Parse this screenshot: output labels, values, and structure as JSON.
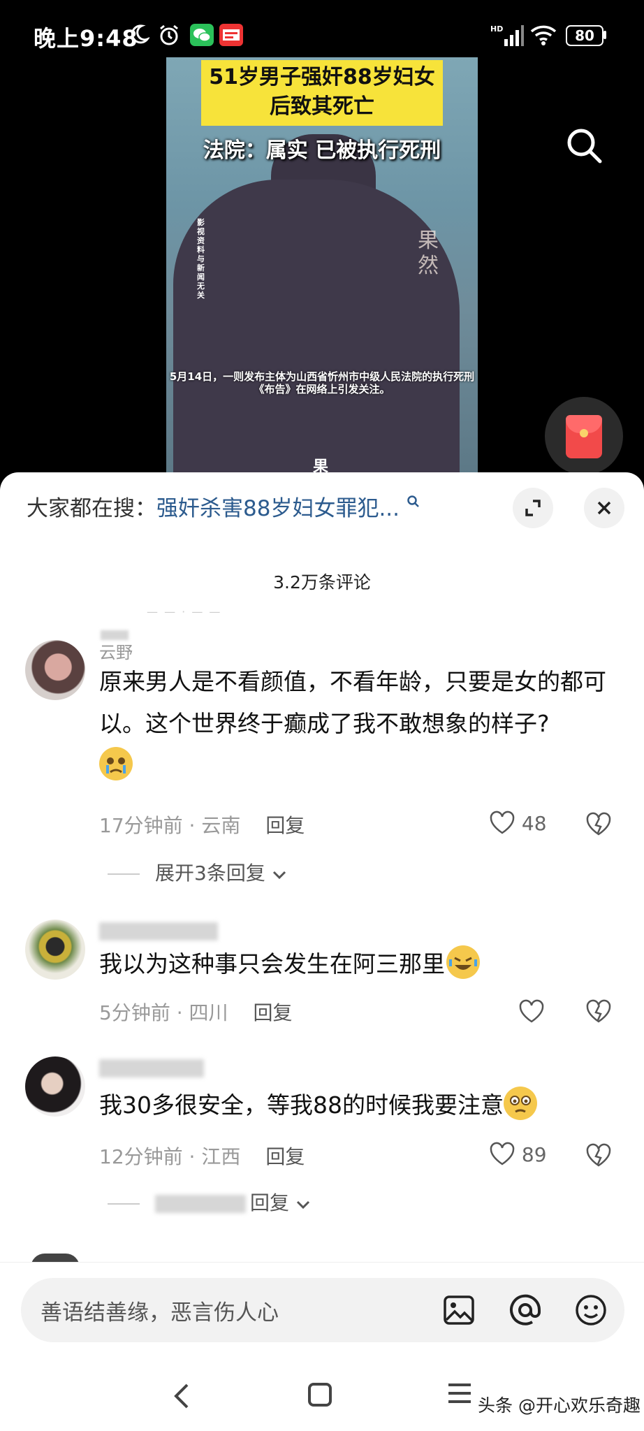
{
  "status_bar": {
    "time": "晚上9:48",
    "network": "HD",
    "battery": "80"
  },
  "video": {
    "headline": "51岁男子强奸88岁妇女后致其死亡",
    "court_line": "法院：属实 已被执行死刑",
    "side_note": "影视资料与新闻无关",
    "watermark": "果然",
    "caption": "5月14日，一则发布主体为山西省忻州市中级人民法院的执行死刑《布告》在网络上引发关注。",
    "bottom_mark": "果"
  },
  "sheet": {
    "search_label": "大家都在搜：",
    "search_link": "强奸杀害88岁妇女罪犯...",
    "comment_count": "3.2万条评论"
  },
  "comments": [
    {
      "username": "云野",
      "text": "原来男人是不看颜值，不看年龄，只要是女的都可以。这个世界终于癫成了我不敢想象的样子?",
      "time": "17分钟前",
      "location": "云南",
      "reply": "回复",
      "likes": "48",
      "expand": "展开3条回复"
    },
    {
      "username": "",
      "text": "我以为这种事只会发生在阿三那里",
      "time": "5分钟前",
      "location": "四川",
      "reply": "回复",
      "likes": ""
    },
    {
      "username": "",
      "text": "我30多很安全，等我88的时候我要注意",
      "time": "12分钟前",
      "location": "江西",
      "reply": "回复",
      "likes": "89",
      "expand": "回复"
    }
  ],
  "input": {
    "placeholder": "善语结善缘，恶言伤人心"
  },
  "credit": "头条 @开心欢乐奇趣"
}
